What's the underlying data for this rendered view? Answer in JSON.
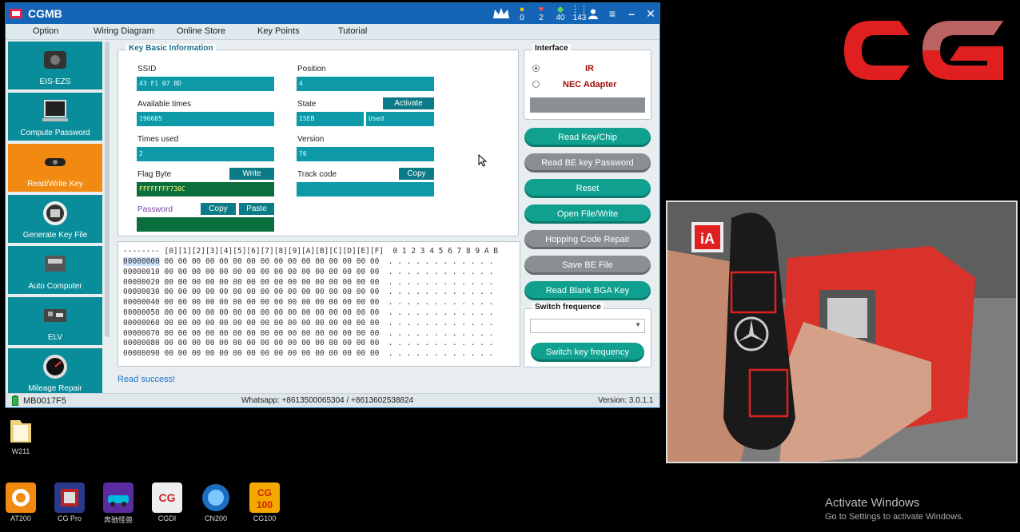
{
  "window": {
    "title": "CGMB",
    "stats": [
      {
        "icon": "coin-icon",
        "value": "0"
      },
      {
        "icon": "heart-icon",
        "value": "2"
      },
      {
        "icon": "diamond-icon",
        "value": "40"
      },
      {
        "icon": "signal-icon",
        "value": "143"
      }
    ]
  },
  "menu": [
    "Option",
    "Wiring Diagram",
    "Online Store",
    "Key Points",
    "Tutorial"
  ],
  "sidebar": [
    {
      "label": "EIS-EZS",
      "icon": "eis-module-icon",
      "active": false
    },
    {
      "label": "Compute Password",
      "icon": "laptop-icon",
      "active": false
    },
    {
      "label": "Read/Write Key",
      "icon": "car-key-icon",
      "active": true
    },
    {
      "label": "Generate Key File",
      "icon": "key-programmer-icon",
      "active": false
    },
    {
      "label": "Auto Computer",
      "icon": "ecu-icon",
      "active": false
    },
    {
      "label": "ELV",
      "icon": "elv-board-icon",
      "active": false
    },
    {
      "label": "Mileage Repair",
      "icon": "gauge-icon",
      "active": false
    }
  ],
  "key_info": {
    "title": "Key Basic Information",
    "ssid_label": "SSID",
    "ssid": "43 F1 07 BD",
    "position_label": "Position",
    "position": "4",
    "available_label": "Available times",
    "available": "196605",
    "state_label": "State",
    "state_a": "15EB",
    "state_b": "Used",
    "activate": "Activate",
    "times_used_label": "Times used",
    "times_used": "2",
    "version_label": "Version",
    "version": "76",
    "flag_label": "Flag Byte",
    "flag": "FFFFFFFF730C",
    "write": "Write",
    "track_label": "Track code",
    "track": "",
    "copy": "Copy",
    "password_label": "Password",
    "password": "",
    "paste": "Paste"
  },
  "hex": {
    "header": "-------- [0][1][2][3][4][5][6][7][8][9][A][B][C][D][E][F]  0 1 2 3 4 5 6 7 8 9 A B",
    "rows": [
      {
        "addr": "00000000",
        "bytes": "00 00 00 00 00 00 00 00 00 00 00 00 00 00 00 00",
        "ascii": ". . . . . . . . . . . ."
      },
      {
        "addr": "00000010",
        "bytes": "00 00 00 00 00 00 00 00 00 00 00 00 00 00 00 00",
        "ascii": ". . . . . . . . . . . ."
      },
      {
        "addr": "00000020",
        "bytes": "00 00 00 00 00 00 00 00 00 00 00 00 00 00 00 00",
        "ascii": ". . . . . . . . . . . ."
      },
      {
        "addr": "00000030",
        "bytes": "00 00 00 00 00 00 00 00 00 00 00 00 00 00 00 00",
        "ascii": ". . . . . . . . . . . ."
      },
      {
        "addr": "00000040",
        "bytes": "00 00 00 00 00 00 00 00 00 00 00 00 00 00 00 00",
        "ascii": ". . . . . . . . . . . ."
      },
      {
        "addr": "00000050",
        "bytes": "00 00 00 00 00 00 00 00 00 00 00 00 00 00 00 00",
        "ascii": ". . . . . . . . . . . ."
      },
      {
        "addr": "00000060",
        "bytes": "00 00 00 00 00 00 00 00 00 00 00 00 00 00 00 00",
        "ascii": ". . . . . . . . . . . ."
      },
      {
        "addr": "00000070",
        "bytes": "00 00 00 00 00 00 00 00 00 00 00 00 00 00 00 00",
        "ascii": ". . . . . . . . . . . ."
      },
      {
        "addr": "00000080",
        "bytes": "00 00 00 00 00 00 00 00 00 00 00 00 00 00 00 00",
        "ascii": ". . . . . . . . . . . ."
      },
      {
        "addr": "00000090",
        "bytes": "00 00 00 00 00 00 00 00 00 00 00 00 00 00 00 00",
        "ascii": ". . . . . . . . . . . ."
      }
    ]
  },
  "status_message": "Read   success!",
  "interface": {
    "title": "Interface",
    "opt1": "IR",
    "opt2": "NEC Adapter",
    "selected": "IR"
  },
  "actions": [
    {
      "label": "Read Key/Chip",
      "style": "teal"
    },
    {
      "label": "Read BE key Password",
      "style": "gray"
    },
    {
      "label": "Reset",
      "style": "teal"
    },
    {
      "label": "Open File/Write",
      "style": "teal"
    },
    {
      "label": "Hopping Code Repair",
      "style": "gray"
    },
    {
      "label": "Save BE File",
      "style": "gray"
    },
    {
      "label": "Read Blank BGA Key",
      "style": "teal"
    }
  ],
  "switch_freq": {
    "title": "Switch frequence",
    "value": "",
    "button": "Switch key frequency"
  },
  "statusbar": {
    "device": "MB0017F5",
    "contact": "Whatsapp: +8613500065304 / +8613602538824",
    "version": "Version: 3.0.1.1"
  },
  "desktop": {
    "folder": "W211",
    "taskbar": [
      "AT200",
      "CG Pro",
      "奔驰怪兽",
      "CGDI",
      "CN200",
      "CG100"
    ],
    "activate_title": "Activate Windows",
    "activate_sub": "Go to Settings to activate Windows."
  },
  "overlay": {
    "badge": "iA"
  },
  "colors": {
    "titlebar": "#1565b6",
    "teal": "#0e99a8",
    "orange": "#f28a12",
    "cg_red": "#e02020"
  }
}
